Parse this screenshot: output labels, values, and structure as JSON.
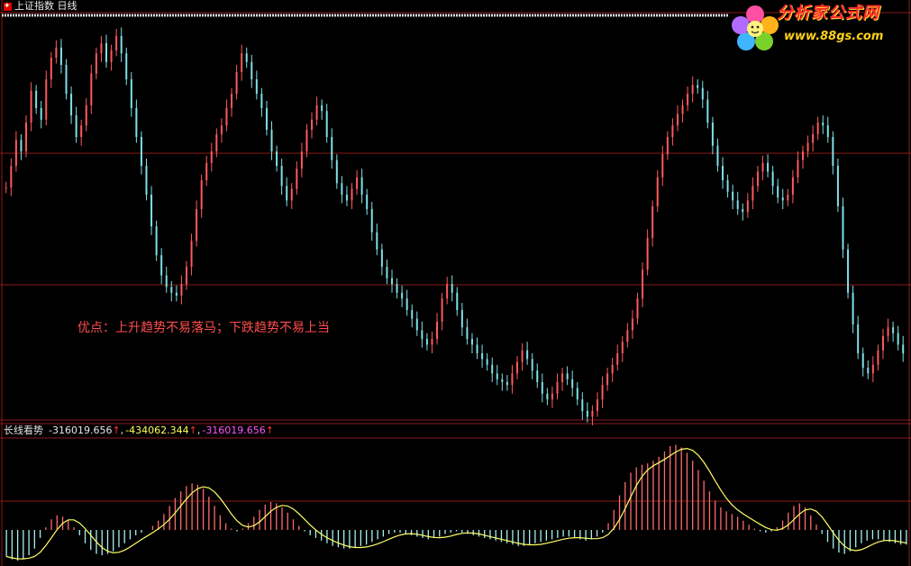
{
  "header": {
    "title": "上证指数 日线"
  },
  "annotation": "优点：上升趋势不易落马；下跌趋势不易上当",
  "indicator": {
    "name": "长线看势",
    "values": [
      "-316019.656",
      "-434062.344",
      "-316019.656"
    ],
    "arrow": "↑",
    "separator": ","
  },
  "brand": {
    "name": "分析家公式网",
    "url": "www.88gs.com"
  },
  "colors": {
    "background": "#000000",
    "grid": "#8b1a1a",
    "up_candle": "#ff5a5a",
    "down_candle": "#7fe0e8",
    "hist_positive": "#ff6a6a",
    "hist_negative": "#a8f0f0",
    "signal_line": "#ffff66",
    "title_text": "#e8e8e8",
    "annotation": "#ff4d4d"
  },
  "chart_data": [
    {
      "type": "candlestick",
      "series": [
        {
          "values": [
            305,
            320,
            338,
            330,
            350,
            372,
            360,
            352,
            380,
            395,
            402,
            390,
            370,
            355,
            340,
            348,
            362,
            384,
            398,
            405,
            392,
            400,
            410,
            398,
            380,
            360,
            340,
            320,
            300,
            278,
            258,
            244,
            236,
            232,
            230,
            238,
            250,
            268,
            290,
            310,
            322,
            330,
            342,
            348,
            360,
            370,
            385,
            398,
            392,
            380,
            370,
            360,
            345,
            330,
            320,
            306,
            296,
            304,
            318,
            330,
            345,
            352,
            362,
            358,
            340,
            324,
            308,
            300,
            296,
            304,
            312,
            300,
            290,
            274,
            262,
            250,
            242,
            238,
            232,
            228,
            220,
            214,
            206,
            200,
            196,
            200,
            212,
            228,
            238,
            232,
            220,
            208,
            200,
            196,
            190,
            186,
            182,
            176,
            172,
            170,
            168,
            176,
            184,
            192,
            186,
            178,
            170,
            162,
            158,
            162,
            170,
            176,
            172,
            166,
            158,
            150,
            146,
            150,
            158,
            168,
            176,
            182,
            190,
            198,
            206,
            214,
            228,
            248,
            270,
            292,
            312,
            328,
            340,
            348,
            356,
            362,
            370,
            376,
            374,
            366,
            350,
            334,
            320,
            310,
            302,
            296,
            290,
            288,
            296,
            306,
            316,
            322,
            316,
            306,
            298,
            296,
            300,
            312,
            324,
            330,
            336,
            342,
            350,
            348,
            340,
            320,
            292,
            262,
            232,
            210,
            190,
            180,
            176,
            182,
            192,
            202,
            208,
            204,
            196,
            190
          ]
        }
      ],
      "ylim": [
        150,
        420
      ]
    },
    {
      "type": "bar",
      "series": [
        {
          "values": [
            -40,
            -44,
            -46,
            -44,
            -38,
            -28,
            -12,
            4,
            16,
            22,
            20,
            14,
            4,
            -8,
            -20,
            -30,
            -36,
            -38,
            -36,
            -32,
            -26,
            -20,
            -14,
            -8,
            -4,
            0,
            6,
            14,
            24,
            36,
            48,
            58,
            66,
            70,
            68,
            62,
            50,
            36,
            22,
            10,
            2,
            -2,
            2,
            10,
            20,
            30,
            38,
            42,
            40,
            34,
            26,
            16,
            6,
            -2,
            -8,
            -12,
            -16,
            -20,
            -24,
            -26,
            -28,
            -28,
            -26,
            -24,
            -22,
            -18,
            -14,
            -10,
            -6,
            -4,
            -4,
            -6,
            -8,
            -10,
            -12,
            -14,
            -12,
            -10,
            -6,
            -4,
            -2,
            -4,
            -6,
            -8,
            -10,
            -12,
            -14,
            -16,
            -18,
            -20,
            -22,
            -24,
            -24,
            -22,
            -20,
            -18,
            -16,
            -14,
            -12,
            -10,
            -10,
            -12,
            -14,
            -16,
            -14,
            -10,
            -4,
            10,
            30,
            52,
            72,
            86,
            94,
            98,
            100,
            104,
            110,
            118,
            126,
            128,
            124,
            116,
            104,
            90,
            74,
            58,
            44,
            34,
            28,
            24,
            20,
            14,
            8,
            2,
            -2,
            -4,
            -2,
            4,
            14,
            26,
            36,
            40,
            34,
            22,
            8,
            -6,
            -18,
            -28,
            -34,
            -36,
            -32,
            -26,
            -20,
            -16,
            -14,
            -14,
            -16,
            -18,
            -20,
            -22,
            -22
          ]
        }
      ]
    }
  ]
}
